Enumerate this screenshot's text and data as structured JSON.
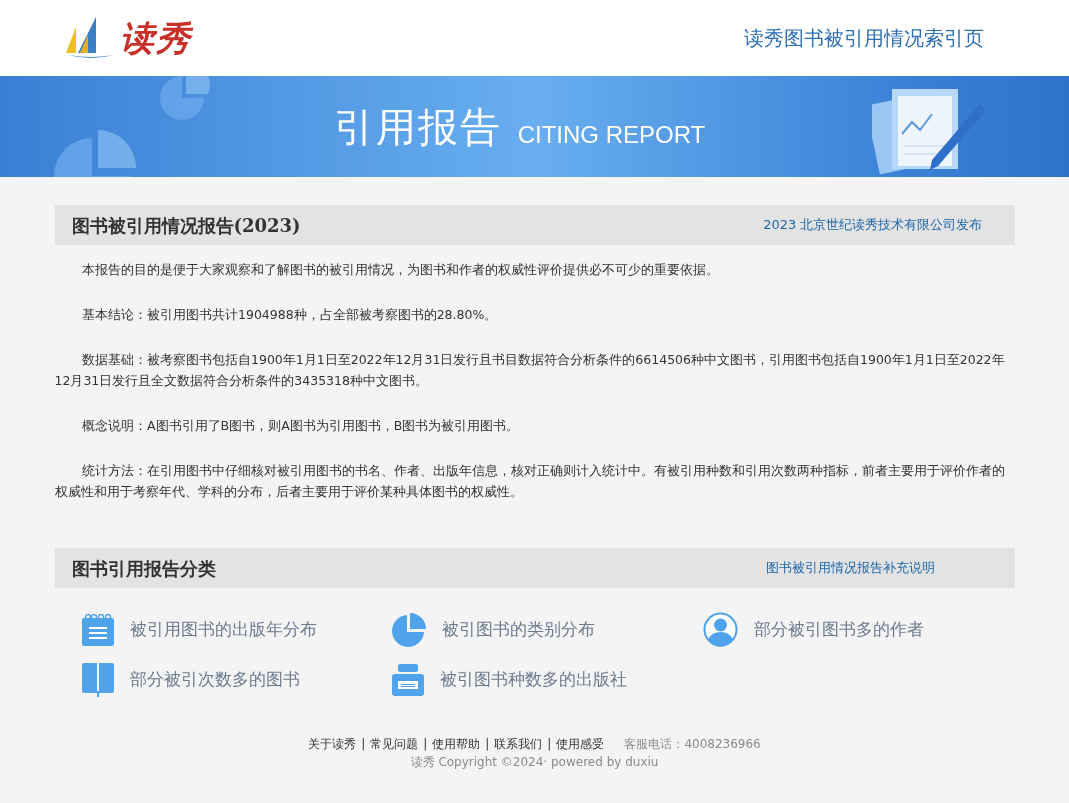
{
  "header": {
    "logo_text": "读秀",
    "title_link": "读秀图书被引用情况索引页"
  },
  "banner": {
    "title": "引用报告",
    "subtitle": "CITING REPORT"
  },
  "report": {
    "title": "图书被引用情况报告(2023)",
    "publisher_link": "2023 北京世纪读秀技术有限公司发布",
    "paragraphs": [
      "本报告的目的是便于大家观察和了解图书的被引用情况，为图书和作者的权威性评价提供必不可少的重要依据。",
      "基本结论：被引用图书共计1904988种，占全部被考察图书的28.80%。",
      "数据基础：被考察图书包括自1900年1月1日至2022年12月31日发行且书目数据符合分析条件的6614506种中文图书，引用图书包括自1900年1月1日至2022年12月31日发行且全文数据符合分析条件的3435318种中文图书。",
      "概念说明：A图书引用了B图书，则A图书为引用图书，B图书为被引用图书。",
      "统计方法：在引用图书中仔细核对被引用图书的书名、作者、出版年信息，核对正确则计入统计中。有被引用种数和引用次数两种指标，前者主要用于评价作者的权威性和用于考察年代、学科的分布，后者主要用于评价某种具体图书的权威性。"
    ]
  },
  "categories": {
    "title": "图书引用报告分类",
    "note_link": "图书被引用情况报告补充说明",
    "items": [
      {
        "kind": "notepad",
        "label": "被引用图书的出版年分布"
      },
      {
        "kind": "pie",
        "label": "被引图书的类别分布"
      },
      {
        "kind": "person",
        "label": "部分被引图书多的作者"
      },
      {
        "kind": "book",
        "label": "部分被引次数多的图书"
      },
      {
        "kind": "printer",
        "label": "被引图书种数多的出版社"
      }
    ]
  },
  "footer": {
    "links": [
      {
        "kind": "link",
        "text": "关于读秀"
      },
      {
        "kind": "sep",
        "text": "|"
      },
      {
        "kind": "link",
        "text": "常见问题"
      },
      {
        "kind": "sep",
        "text": "|"
      },
      {
        "kind": "link",
        "text": "使用帮助"
      },
      {
        "kind": "sep",
        "text": "|"
      },
      {
        "kind": "link",
        "text": "联系我们"
      },
      {
        "kind": "sep",
        "text": "|"
      },
      {
        "kind": "link",
        "text": "使用感受"
      }
    ],
    "hotline": "客服电话：4008236966",
    "copyright": "读秀 Copyright ©2024· powered by duxiu"
  }
}
